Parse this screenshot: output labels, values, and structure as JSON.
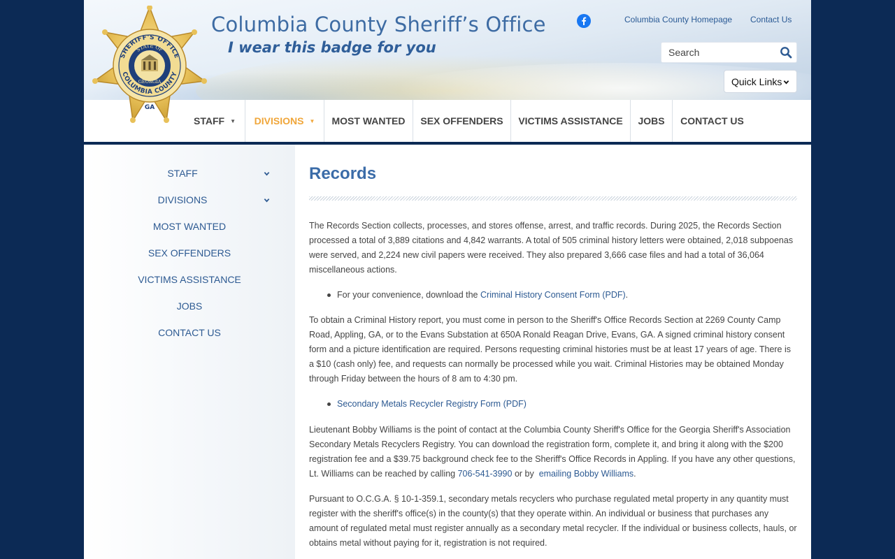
{
  "header": {
    "site_title": "Columbia County Sheriff’s Office",
    "tagline": "I wear this badge for you",
    "badge_text": {
      "top": "SHERIFF'S OFFICE",
      "inner": "STATE OF",
      "state": "GEORGIA",
      "bottom": "COLUMBIA COUNTY",
      "tip": "GA"
    },
    "links": {
      "homepage": "Columbia County Homepage",
      "contact": "Contact Us"
    },
    "search_placeholder": "Search",
    "quick_links": "Quick Links"
  },
  "nav": {
    "items": [
      {
        "label": "STAFF"
      },
      {
        "label": "DIVISIONS"
      },
      {
        "label": "MOST WANTED"
      },
      {
        "label": "SEX OFFENDERS"
      },
      {
        "label": "VICTIMS ASSISTANCE"
      },
      {
        "label": "JOBS"
      },
      {
        "label": "CONTACT US"
      }
    ]
  },
  "sidebar": {
    "items": [
      {
        "label": "STAFF"
      },
      {
        "label": "DIVISIONS"
      },
      {
        "label": "MOST WANTED"
      },
      {
        "label": "SEX OFFENDERS"
      },
      {
        "label": "VICTIMS ASSISTANCE"
      },
      {
        "label": "JOBS"
      },
      {
        "label": "CONTACT US"
      }
    ]
  },
  "content": {
    "title": "Records",
    "p1": "The Records Section collects, processes, and stores offense, arrest, and traffic records. During 2025, the Records Section processed a total of 3,889 citations and 4,842 warrants. A total of 505 criminal history letters were obtained, 2,018 subpoenas were served, and 2,224 new civil papers were received. They also prepared 3,666 case files and had a total of 36,064 miscellaneous actions.",
    "b1_prefix": "For your convenience, download the ",
    "b1_link": "Criminal History Consent Form (PDF)",
    "b1_suffix": ".",
    "p2": "To obtain a Criminal History report, you must come in person to the Sheriff's Office Records Section at 2269 County Camp Road, Appling, GA, or to the Evans Substation at 650A Ronald Reagan Drive, Evans, GA. A signed criminal history consent form and a picture identification are required. Persons requesting criminal histories must be at least 17 years of age. There is a $10 (cash only) fee, and requests can normally be processed while you wait. Criminal Histories may be obtained Monday through Friday between the hours of 8 am to 4:30 pm.",
    "b2_link": "Secondary Metals Recycler Registry Form (PDF)",
    "p3_prefix": "Lieutenant Bobby Williams is the point of contact at the Columbia County Sheriff's Office for the Georgia Sheriff's Association Secondary Metals Recyclers Registry. You can download the registration form, complete it, and bring it along with the $200 registration fee and a $39.75 background check fee to the Sheriff's Office Records in Appling. If you have any other questions, Lt. Williams can be reached by calling ",
    "p3_phone": "706-541-3990",
    "p3_mid": " or by  ",
    "p3_email": "emailing Bobby Williams",
    "p3_suffix": ".",
    "p4": "Pursuant to O.C.G.A. § 10-1-359.1, secondary metals recyclers who purchase regulated metal property in any quantity must register with the sheriff's office(s) in the county(s) that they operate within. An individual or business that purchases any amount of regulated metal must register annually as a secondary metal recycler. If the individual or business collects, hauls, or obtains metal without paying for it, registration is not required."
  },
  "colors": {
    "background": "#0c2a55",
    "brand_blue": "#3b6ca8",
    "link": "#2d5a92",
    "active_nav": "#f0a63a",
    "badge_gold": "#e8c15a"
  },
  "icons": {
    "facebook": "facebook-icon",
    "search": "search-icon",
    "dropdown": "chevron-down-icon"
  }
}
